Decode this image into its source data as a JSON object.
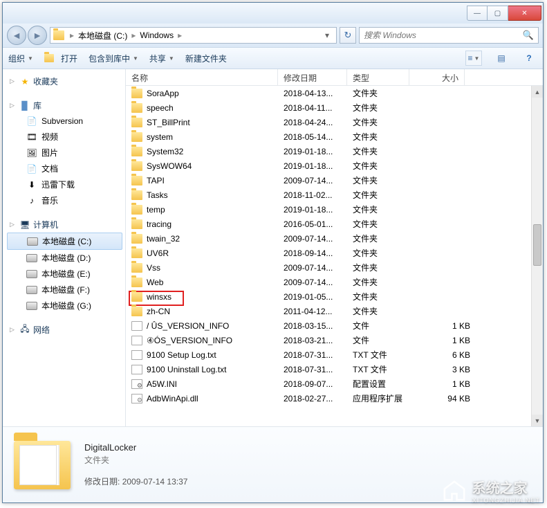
{
  "titlebar": {
    "min": "—",
    "max": "▢",
    "close": "✕"
  },
  "nav": {
    "back": "◄",
    "forward": "►"
  },
  "breadcrumb": {
    "icon": "folder",
    "parts": [
      "本地磁盘 (C:)",
      "Windows"
    ],
    "dropdown": "▾",
    "refresh": "↻"
  },
  "search": {
    "placeholder": "搜索 Windows",
    "icon": "🔍"
  },
  "toolbar": {
    "organize": "组织",
    "open": "打开",
    "include": "包含到库中",
    "share": "共享",
    "newfolder": "新建文件夹",
    "view_icon": "☰",
    "preview_icon": "▤",
    "help_icon": "?"
  },
  "sidebar": {
    "favorites": {
      "label": "收藏夹",
      "icon": "★"
    },
    "libraries": {
      "label": "库",
      "items": [
        {
          "label": "Subversion",
          "icon": "doc"
        },
        {
          "label": "视频",
          "icon": "vid"
        },
        {
          "label": "图片",
          "icon": "pic"
        },
        {
          "label": "文档",
          "icon": "doc"
        },
        {
          "label": "迅雷下载",
          "icon": "dl"
        },
        {
          "label": "音乐",
          "icon": "mus"
        }
      ]
    },
    "computer": {
      "label": "计算机",
      "items": [
        {
          "label": "本地磁盘 (C:)",
          "selected": true
        },
        {
          "label": "本地磁盘 (D:)"
        },
        {
          "label": "本地磁盘 (E:)"
        },
        {
          "label": "本地磁盘 (F:)"
        },
        {
          "label": "本地磁盘 (G:)"
        }
      ]
    },
    "network": {
      "label": "网络",
      "icon": "net"
    }
  },
  "columns": {
    "name": "名称",
    "date": "修改日期",
    "type": "类型",
    "size": "大小"
  },
  "files": [
    {
      "name": "SoraApp",
      "date": "2018-04-13...",
      "type": "文件夹",
      "size": "",
      "icon": "folder"
    },
    {
      "name": "speech",
      "date": "2018-04-11...",
      "type": "文件夹",
      "size": "",
      "icon": "folder"
    },
    {
      "name": "ST_BillPrint",
      "date": "2018-04-24...",
      "type": "文件夹",
      "size": "",
      "icon": "folder"
    },
    {
      "name": "system",
      "date": "2018-05-14...",
      "type": "文件夹",
      "size": "",
      "icon": "folder"
    },
    {
      "name": "System32",
      "date": "2019-01-18...",
      "type": "文件夹",
      "size": "",
      "icon": "folder"
    },
    {
      "name": "SysWOW64",
      "date": "2019-01-18...",
      "type": "文件夹",
      "size": "",
      "icon": "folder"
    },
    {
      "name": "TAPI",
      "date": "2009-07-14...",
      "type": "文件夹",
      "size": "",
      "icon": "folder"
    },
    {
      "name": "Tasks",
      "date": "2018-11-02...",
      "type": "文件夹",
      "size": "",
      "icon": "folder"
    },
    {
      "name": "temp",
      "date": "2019-01-18...",
      "type": "文件夹",
      "size": "",
      "icon": "folder"
    },
    {
      "name": "tracing",
      "date": "2016-05-01...",
      "type": "文件夹",
      "size": "",
      "icon": "folder"
    },
    {
      "name": "twain_32",
      "date": "2009-07-14...",
      "type": "文件夹",
      "size": "",
      "icon": "folder"
    },
    {
      "name": "UV6R",
      "date": "2018-09-14...",
      "type": "文件夹",
      "size": "",
      "icon": "folder"
    },
    {
      "name": "Vss",
      "date": "2009-07-14...",
      "type": "文件夹",
      "size": "",
      "icon": "folder"
    },
    {
      "name": "Web",
      "date": "2009-07-14...",
      "type": "文件夹",
      "size": "",
      "icon": "folder"
    },
    {
      "name": "winsxs",
      "date": "2019-01-05...",
      "type": "文件夹",
      "size": "",
      "icon": "folder",
      "highlight": true
    },
    {
      "name": "zh-CN",
      "date": "2011-04-12...",
      "type": "文件夹",
      "size": "",
      "icon": "folder"
    },
    {
      "name": "/ ÛS_VERSION_INFO",
      "date": "2018-03-15...",
      "type": "文件",
      "size": "1 KB",
      "icon": "file"
    },
    {
      "name": "④ÓS_VERSION_INFO",
      "date": "2018-03-21...",
      "type": "文件",
      "size": "1 KB",
      "icon": "file"
    },
    {
      "name": "9100 Setup Log.txt",
      "date": "2018-07-31...",
      "type": "TXT 文件",
      "size": "6 KB",
      "icon": "txt"
    },
    {
      "name": "9100 Uninstall Log.txt",
      "date": "2018-07-31...",
      "type": "TXT 文件",
      "size": "3 KB",
      "icon": "txt"
    },
    {
      "name": "A5W.INI",
      "date": "2018-09-07...",
      "type": "配置设置",
      "size": "1 KB",
      "icon": "ini"
    },
    {
      "name": "AdbWinApi.dll",
      "date": "2018-02-27...",
      "type": "应用程序扩展",
      "size": "94 KB",
      "icon": "dll"
    }
  ],
  "details": {
    "name": "DigitalLocker",
    "type": "文件夹",
    "date_label": "修改日期:",
    "date_value": "2009-07-14 13:37"
  },
  "watermark": {
    "text": "系统之家",
    "sub": "XITONGZHIJIA.NET"
  }
}
